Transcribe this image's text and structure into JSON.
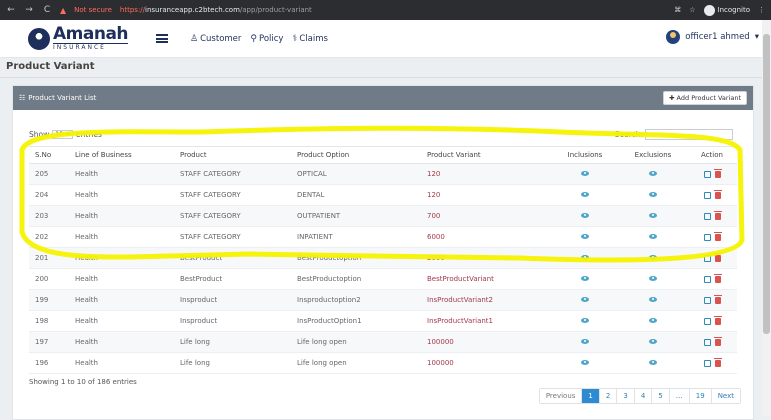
{
  "browser": {
    "nav": [
      "←",
      "→",
      "C"
    ],
    "not_secure": "Not secure",
    "url_https": "https://",
    "url_host": "insuranceapp.c2btech.com",
    "url_path": "/app/product-variant",
    "incognito_label": "Incognito"
  },
  "header": {
    "logo_main": "Amanah",
    "logo_sub": "INSURANCE",
    "nav": [
      {
        "label": "Customer",
        "icon": "user-icon"
      },
      {
        "label": "Policy",
        "icon": "umbrella-icon"
      },
      {
        "label": "Claims",
        "icon": "claims-icon"
      }
    ],
    "user_name": "officer1 ahmed"
  },
  "page": {
    "title": "Product Variant",
    "panel_title": "Product Variant List",
    "add_button": "Add Product Variant",
    "show_label": "Show",
    "show_value": "10",
    "entries_label": "entries",
    "search_label": "Search:",
    "info": "Showing 1 to 10 of 186 entries"
  },
  "table": {
    "columns": [
      "S.No",
      "Line of Business",
      "Product",
      "Product Option",
      "Product Variant",
      "Inclusions",
      "Exclusions",
      "Action"
    ],
    "rows": [
      [
        "205",
        "Health",
        "STAFF CATEGORY",
        "OPTICAL",
        "120"
      ],
      [
        "204",
        "Health",
        "STAFF CATEGORY",
        "DENTAL",
        "120"
      ],
      [
        "203",
        "Health",
        "STAFF CATEGORY",
        "OUTPATIENT",
        "700"
      ],
      [
        "202",
        "Health",
        "STAFF CATEGORY",
        "INPATIENT",
        "6000"
      ],
      [
        "201",
        "Health",
        "BestProduct",
        "BestProductoption",
        "2000"
      ],
      [
        "200",
        "Health",
        "BestProduct",
        "BestProductoption",
        "BestProductVariant"
      ],
      [
        "199",
        "Health",
        "Insproduct",
        "Insproductoption2",
        "InsProductVariant2"
      ],
      [
        "198",
        "Health",
        "Insproduct",
        "InsProductOption1",
        "InsProductVariant1"
      ],
      [
        "197",
        "Health",
        "Life long",
        "Life long open",
        "100000"
      ],
      [
        "196",
        "Health",
        "Life long",
        "Life long open",
        "100000"
      ]
    ]
  },
  "pagination": {
    "previous": "Previous",
    "pages": [
      "1",
      "2",
      "3",
      "4",
      "5",
      "…",
      "19"
    ],
    "active": "1",
    "next": "Next"
  },
  "colors": {
    "highlight": "#f5f200",
    "panel_header": "#6f7b86",
    "brand": "#1f2f5c"
  }
}
